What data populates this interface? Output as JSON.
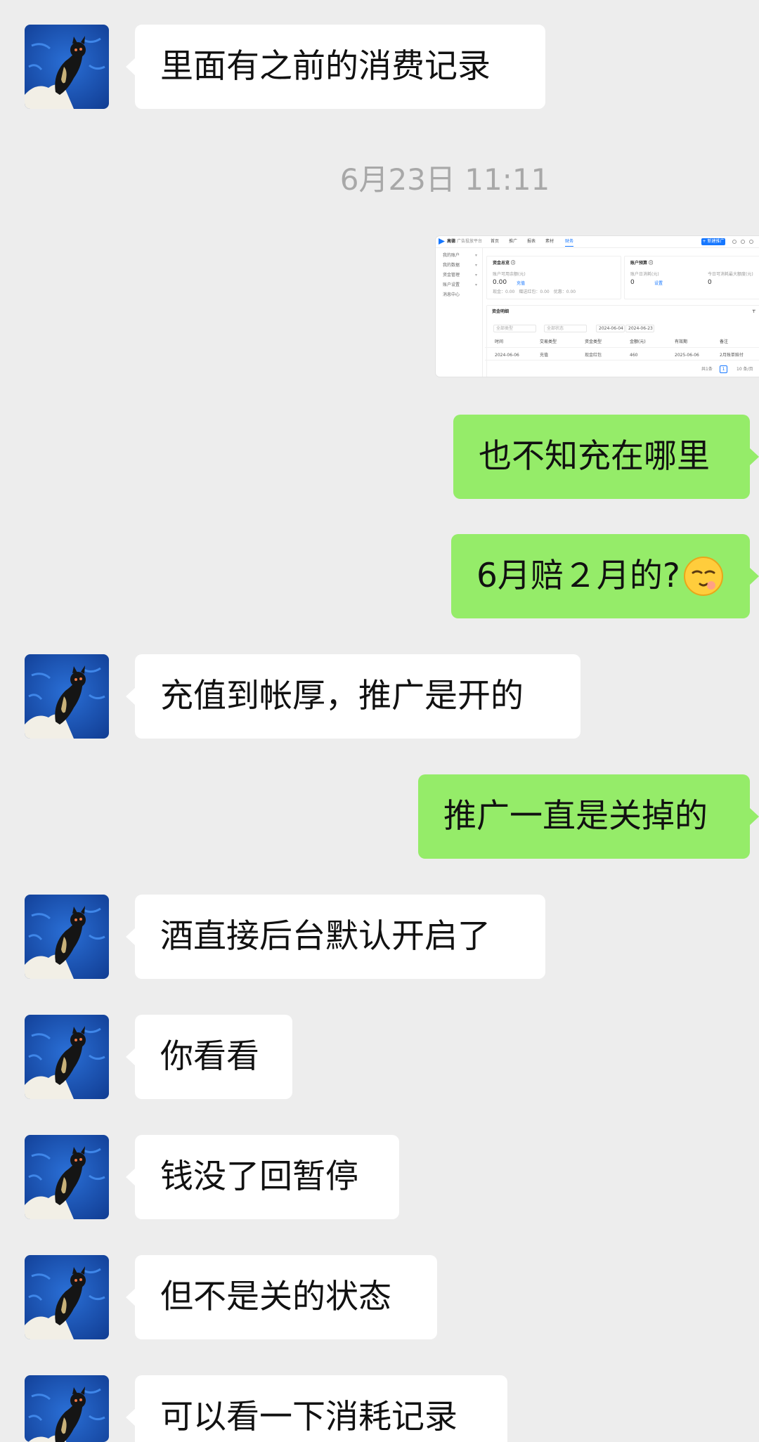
{
  "messages": {
    "m1": "里面有之前的消费记录",
    "timestamp": "6月23日 11:11",
    "m2": "也不知充在哪里",
    "m3": "6月赔２月的?",
    "m3_emoji": "face-with-one-eye-closed-emoji",
    "m4": "充值到帐厚，推广是开的",
    "m5": "推广一直是关掉的",
    "m6": "酒直接后台默认开启了",
    "m7": "你看看",
    "m8": "钱没了回暂停",
    "m9": "但不是关的状态",
    "m10": "可以看一下消耗记录"
  },
  "screenshot": {
    "brand": "高德",
    "brand_sub": "广告投放平台",
    "nav": [
      "首页",
      "推广",
      "报表",
      "素材",
      "财务"
    ],
    "create_button": "+ 新建推广",
    "sidebar": [
      "我的账户",
      "我的数据",
      "资金管理",
      "账户设置",
      "消息中心"
    ],
    "fund_card": {
      "title": "资金总览 ⓘ",
      "sub": "账户可用余额(元)",
      "value": "0.00",
      "link": "充值",
      "detail": "现金：0.00　赠送红包：0.00　优惠：0.00"
    },
    "budget_card": {
      "title": "账户预算 ⓘ",
      "sub1": "账户日消耗(元)",
      "value1": "0",
      "link": "设置",
      "sub2": "今日可消耗最大额度(元)",
      "value2": "0"
    },
    "detail_title": "资金明细",
    "filters": [
      "全部类型",
      "全部状态",
      "2024-06-04",
      "2024-06-23"
    ],
    "table_headers": [
      "时间",
      "交易类型",
      "资金类型",
      "金额(元)",
      "有效期",
      "备注"
    ],
    "table_row": [
      "2024-06-06",
      "充值",
      "现金红包",
      "460",
      "2025-06-06",
      "2月账单赔付"
    ],
    "pagination": [
      "共1条",
      "1",
      "10 条/页"
    ]
  },
  "colors": {
    "chat_bg": "#ededed",
    "incoming_bubble": "#ffffff",
    "outgoing_bubble": "#95ec69",
    "timestamp": "#a8a8a8",
    "avatar_bg": "#1a55b8"
  }
}
